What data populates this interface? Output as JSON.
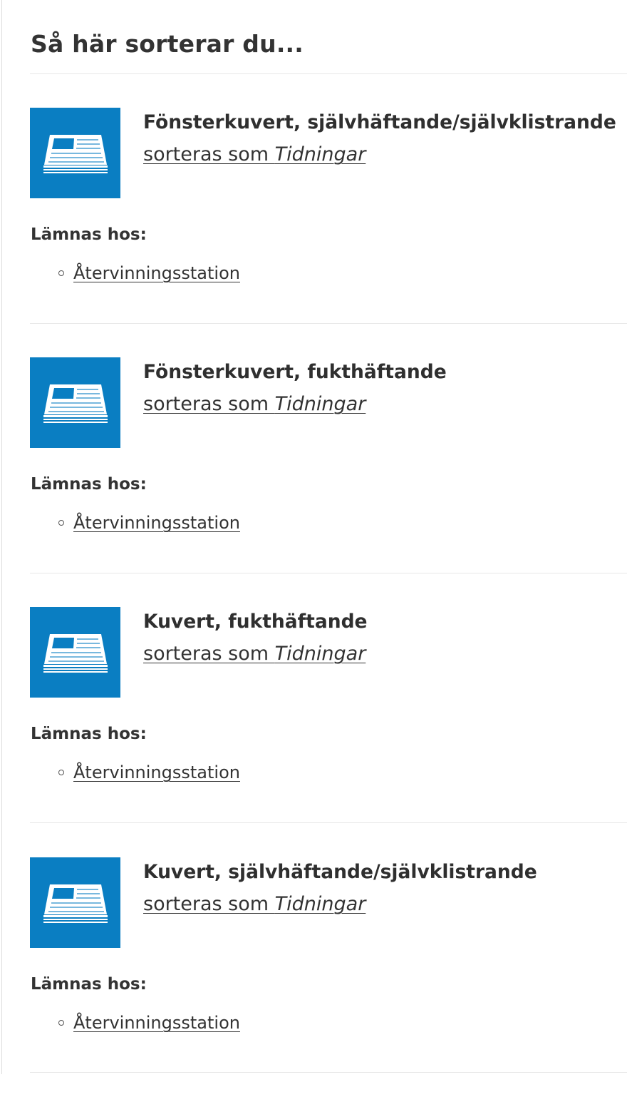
{
  "page_title": "Så här sorterar du...",
  "colors": {
    "icon_background": "#0a7ec2",
    "text": "#333333",
    "divider": "#e8e8e8"
  },
  "items": [
    {
      "name": "Fönsterkuvert, självhäftande/självklistrande",
      "sorted_prefix": "sorteras som ",
      "category": "Tidningar",
      "icon": "newspaper-icon",
      "drop_off_label": "Lämnas hos:",
      "locations": [
        "Återvinningsstation"
      ]
    },
    {
      "name": "Fönsterkuvert, fukthäftande",
      "sorted_prefix": "sorteras som ",
      "category": "Tidningar",
      "icon": "newspaper-icon",
      "drop_off_label": "Lämnas hos:",
      "locations": [
        "Återvinningsstation"
      ]
    },
    {
      "name": "Kuvert, fukthäftande",
      "sorted_prefix": "sorteras som ",
      "category": "Tidningar",
      "icon": "newspaper-icon",
      "drop_off_label": "Lämnas hos:",
      "locations": [
        "Återvinningsstation"
      ]
    },
    {
      "name": "Kuvert, självhäftande/självklistrande",
      "sorted_prefix": "sorteras som ",
      "category": "Tidningar",
      "icon": "newspaper-icon",
      "drop_off_label": "Lämnas hos:",
      "locations": [
        "Återvinningsstation"
      ]
    }
  ]
}
